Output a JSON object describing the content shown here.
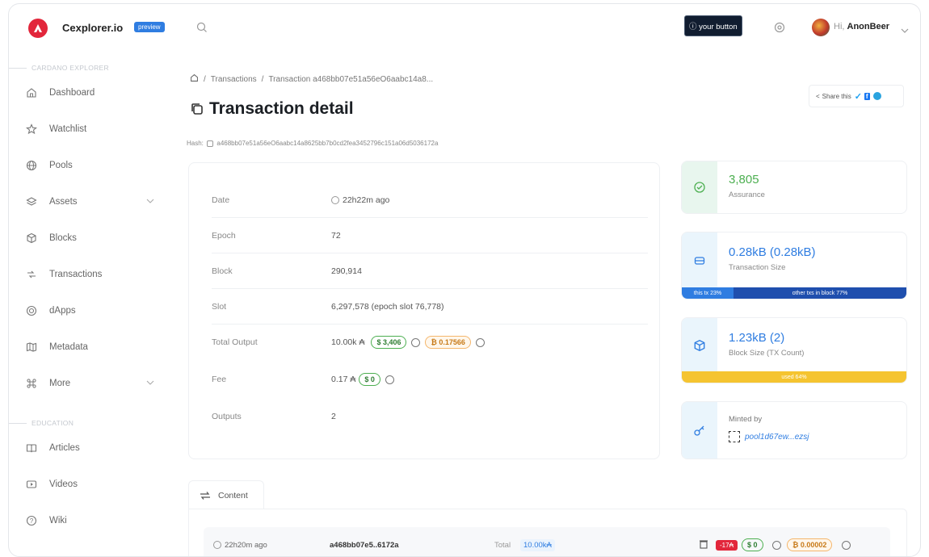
{
  "header": {
    "brand": "Cexplorer.io",
    "preview_badge": "preview",
    "your_button": "your button",
    "greeting_prefix": "Hi,",
    "user_name": "AnonBeer"
  },
  "sidebar": {
    "section_cardano": "CARDANO EXPLORER",
    "section_education": "EDUCATION",
    "items": [
      {
        "label": "Dashboard",
        "icon": "home-icon"
      },
      {
        "label": "Watchlist",
        "icon": "star-icon"
      },
      {
        "label": "Pools",
        "icon": "globe-icon"
      },
      {
        "label": "Assets",
        "icon": "layers-icon"
      },
      {
        "label": "Blocks",
        "icon": "cube-icon"
      },
      {
        "label": "Transactions",
        "icon": "arrows-icon"
      },
      {
        "label": "dApps",
        "icon": "dapps-icon"
      },
      {
        "label": "Metadata",
        "icon": "map-icon"
      },
      {
        "label": "More",
        "icon": "command-icon"
      }
    ],
    "education_items": [
      {
        "label": "Articles",
        "icon": "book-icon"
      },
      {
        "label": "Videos",
        "icon": "video-icon"
      },
      {
        "label": "Wiki",
        "icon": "help-icon"
      }
    ]
  },
  "breadcrumb": {
    "sep": "/",
    "transactions": "Transactions",
    "current": "Transaction a468bb07e51a56eO6aabc14a8..."
  },
  "page": {
    "title": "Transaction detail",
    "share_label": "Share this",
    "hash_label": "Hash:",
    "hash_value": "a468bb07e51a56eO6aabc14a8625bb7b0cd2fea3452796c151a06d5036172a"
  },
  "details": {
    "rows": [
      {
        "label": "Date",
        "value": "22h22m ago"
      },
      {
        "label": "Epoch",
        "value": "72"
      },
      {
        "label": "Block",
        "value": "290,914"
      },
      {
        "label": "Slot",
        "value": "6,297,578 (epoch slot 76,778)"
      },
      {
        "label": "Total Output",
        "value": "10.00k ₳",
        "pill_usd": "$ 3,406",
        "pill_btc": "₿ 0.17566"
      },
      {
        "label": "Fee",
        "value": "0.17 ₳",
        "pill_usd": "$ 0"
      },
      {
        "label": "Outputs",
        "value": "2"
      }
    ]
  },
  "stats": {
    "assurance_value": "3,805",
    "assurance_label": "Assurance",
    "size_value": "0.28kB (0.28kB)",
    "size_label": "Transaction Size",
    "size_bar_this": "this tx 23%",
    "size_bar_other": "other txs in block 77%",
    "size_bar_pct": 23,
    "block_value": "1.23kB (2)",
    "block_label": "Block Size (TX Count)",
    "block_bar_text": "used 64%",
    "minted_label": "Minted by",
    "minted_value": "pool1d67ew...ezsj"
  },
  "content": {
    "tab_label": "Content",
    "time": "22h20m ago",
    "tx_hash": "a468bb07e5..6172a",
    "total_label": "Total",
    "total_value": "10.00k₳",
    "badge_red": "-17₳",
    "pill_usd": "$ 0",
    "pill_btc": "₿ 0.00002"
  },
  "colors": {
    "accent": "#2f7de1",
    "brand_red": "#e2263b",
    "bar_blue": "#1f4fae",
    "bar_yellow": "#f5c430"
  }
}
